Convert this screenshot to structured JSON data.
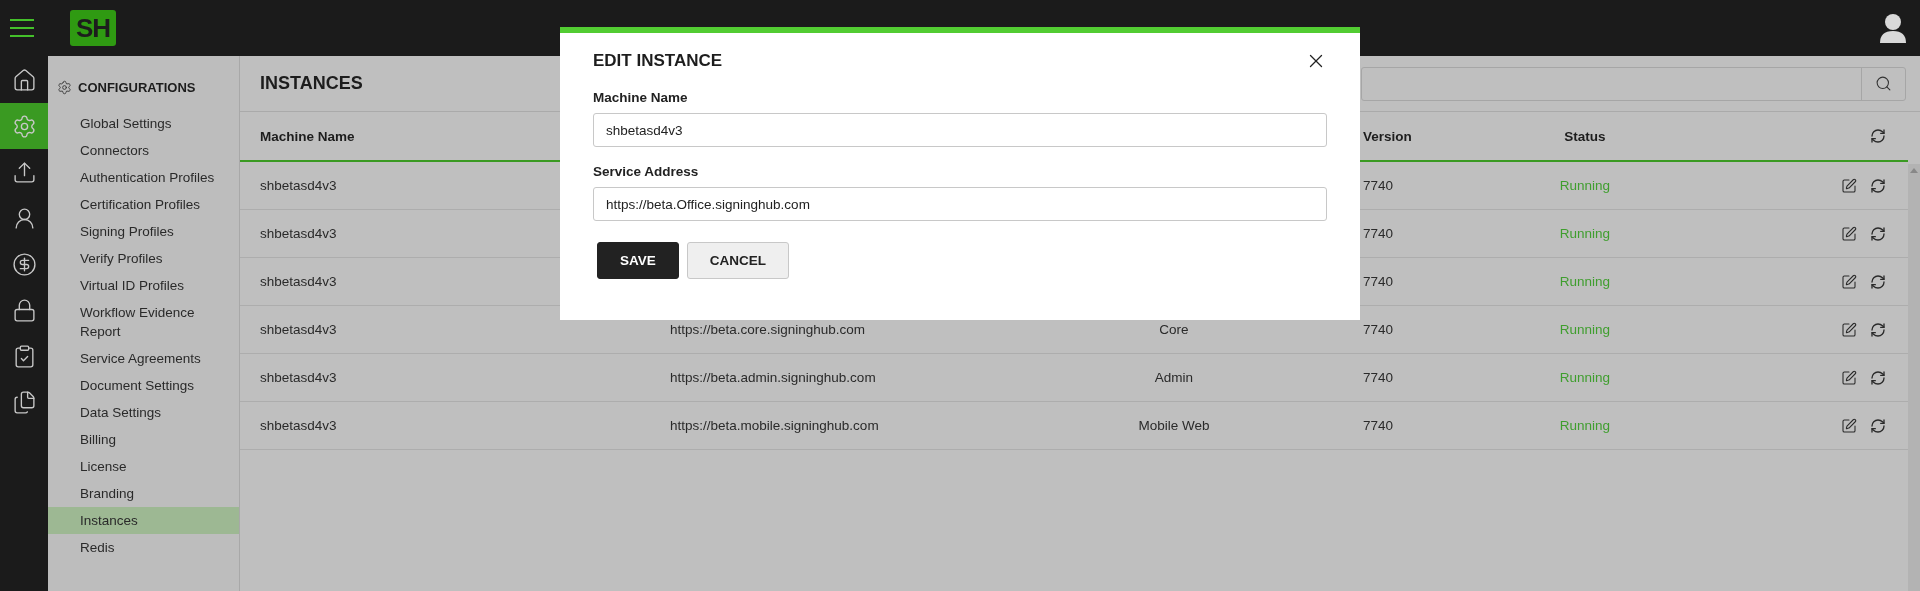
{
  "logo": {
    "text": "SH"
  },
  "icon_rail": [
    {
      "kind": "home",
      "selected": false
    },
    {
      "kind": "settings",
      "selected": true
    },
    {
      "kind": "upload",
      "selected": false
    },
    {
      "kind": "user",
      "selected": false
    },
    {
      "kind": "dollar",
      "selected": false
    },
    {
      "kind": "lock",
      "selected": false
    },
    {
      "kind": "clipboard",
      "selected": false
    },
    {
      "kind": "document",
      "selected": false
    }
  ],
  "sidebar": {
    "title": "CONFIGURATIONS",
    "items": [
      {
        "label": "Global Settings",
        "selected": false
      },
      {
        "label": "Connectors",
        "selected": false
      },
      {
        "label": "Authentication Profiles",
        "selected": false
      },
      {
        "label": "Certification Profiles",
        "selected": false
      },
      {
        "label": "Signing Profiles",
        "selected": false
      },
      {
        "label": "Verify Profiles",
        "selected": false
      },
      {
        "label": "Virtual ID Profiles",
        "selected": false
      },
      {
        "label": "Workflow Evidence Report",
        "selected": false
      },
      {
        "label": "Service Agreements",
        "selected": false
      },
      {
        "label": "Document Settings",
        "selected": false
      },
      {
        "label": "Data Settings",
        "selected": false
      },
      {
        "label": "Billing",
        "selected": false
      },
      {
        "label": "License",
        "selected": false
      },
      {
        "label": "Branding",
        "selected": false
      },
      {
        "label": "Instances",
        "selected": true
      },
      {
        "label": "Redis",
        "selected": false
      }
    ]
  },
  "page": {
    "title": "INSTANCES"
  },
  "table": {
    "columns": [
      {
        "label": "Machine Name"
      },
      {
        "label": "Version"
      },
      {
        "label": "Status"
      }
    ],
    "rows": [
      {
        "machine_name": "shbetasd4v3",
        "version": "7740",
        "status": "Running"
      },
      {
        "machine_name": "shbetasd4v3",
        "version": "7740",
        "status": "Running"
      },
      {
        "machine_name": "shbetasd4v3",
        "version": "7740",
        "status": "Running"
      },
      {
        "machine_name": "shbetasd4v3",
        "service_address": "https://beta.core.signinghub.com",
        "type": "Core",
        "version": "7740",
        "status": "Running"
      },
      {
        "machine_name": "shbetasd4v3",
        "service_address": "https://beta.admin.signinghub.com",
        "type": "Admin",
        "version": "7740",
        "status": "Running"
      },
      {
        "machine_name": "shbetasd4v3",
        "service_address": "https://beta.mobile.signinghub.com",
        "type": "Mobile Web",
        "version": "7740",
        "status": "Running"
      }
    ]
  },
  "dialog": {
    "title": "EDIT INSTANCE",
    "fields": [
      {
        "label": "Machine Name",
        "value": "shbetasd4v3"
      },
      {
        "label": "Service Address",
        "value": "https://beta.Office.signinghub.com"
      }
    ],
    "buttons": [
      {
        "label": "SAVE",
        "kind": "primary"
      },
      {
        "label": "CANCEL",
        "kind": "secondary"
      }
    ]
  }
}
